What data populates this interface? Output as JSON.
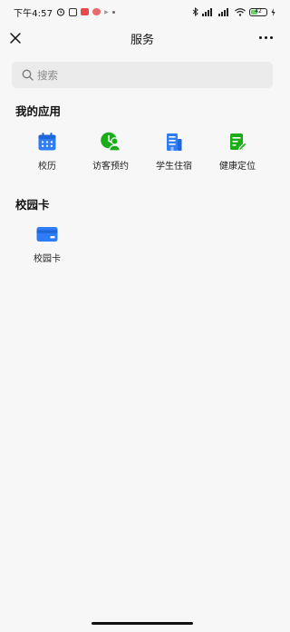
{
  "status_bar": {
    "time": "下午4:57",
    "battery_percent": 42,
    "battery_label": "42"
  },
  "header": {
    "title": "服务"
  },
  "search": {
    "placeholder": "搜索"
  },
  "sections": {
    "my_apps": {
      "title": "我的应用",
      "items": [
        {
          "label": "校历",
          "icon": "calendar-icon",
          "color": "#2e7cf6"
        },
        {
          "label": "访客预约",
          "icon": "visitor-icon",
          "color": "#1aad19"
        },
        {
          "label": "学生住宿",
          "icon": "dorm-building-icon",
          "color": "#2e7cf6"
        },
        {
          "label": "健康定位",
          "icon": "health-edit-icon",
          "color": "#1aad19"
        }
      ]
    },
    "campus_card": {
      "title": "校园卡",
      "items": [
        {
          "label": "校园卡",
          "icon": "card-icon",
          "color": "#2e7cf6"
        }
      ]
    }
  }
}
